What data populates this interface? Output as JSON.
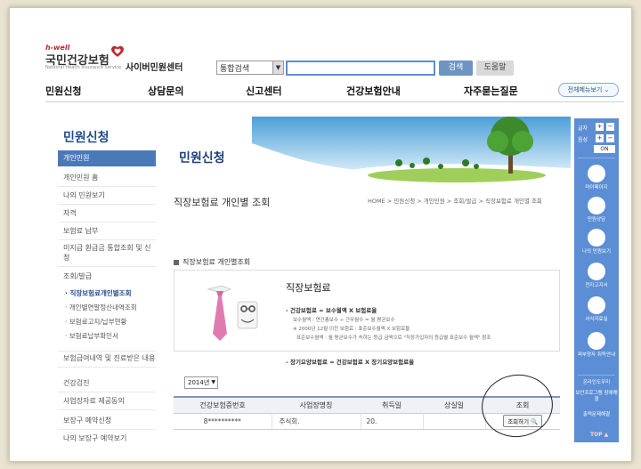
{
  "header": {
    "logo_top": "h-well",
    "logo_main": "국민건강보험",
    "logo_sub": "National Health Insurance Service",
    "center_name": "사이버민원센터",
    "search_select": "통합검색",
    "search_button": "검색",
    "help_button": "도움말",
    "all_menu": "전체메뉴보기"
  },
  "gnb": [
    "민원신청",
    "상담문의",
    "신고센터",
    "건강보험안내",
    "자주묻는질문"
  ],
  "lnb": {
    "title": "민원신청",
    "active": "개인민원",
    "items": [
      "개인민원 홈",
      "나의 민원보기",
      "자격",
      "보험료 납부",
      "미지급 환급금 통합조회 및 신청",
      "조회/발급"
    ],
    "subs": [
      "직장보험료개인별조회",
      "개인별연말정산내역조회",
      "보험료고지/납부현황",
      "보험료납부확인서"
    ],
    "items2": [
      "보험급여내역 및 진료받은 내용",
      "건강검진",
      "사업장자료 제공동의",
      "보장구 예약신청",
      "나의 보장구 예약보기"
    ]
  },
  "main": {
    "page_title": "민원신청",
    "sub_title": "직장보험료 개인별 조회",
    "breadcrumb": "HOME > 민원신청 > 개인민원 > 조회/발급 > 직장보험료 개인별 조회",
    "section_label": "직장보험료 개인별조회",
    "box_title": "직장보험료",
    "formula1": "- 건강보험료 = 보수월액 X 보험료율",
    "formula_lines": [
      "보수월액 : 연간총보수 ÷ 근무월수 = 월 평균보수",
      "※ 2000년 12월 이전 보험료 : 표준보수월액 X 보험료율",
      "표준보수월액 : 월 평균보수가 속하는 등급 금액으로 \"직장가입자의 등급별 표준보수 월액\" 참조"
    ],
    "formula2": "- 장기요양보험료 = 건강보험료 X 장기요양보험료율",
    "year": "2014년"
  },
  "table": {
    "headers": [
      "건강보험증번호",
      "사업장명칭",
      "취득일",
      "상실일",
      "조회"
    ],
    "rows": [
      {
        "card": "8**********",
        "company": "주식회.",
        "acquired": "20.",
        "lost": "",
        "action": "조회하기"
      }
    ]
  },
  "quick": {
    "font_label": "글자",
    "sound_label": "음성",
    "plus": "+",
    "minus": "−",
    "on": "ON",
    "items": [
      "마이페이지",
      "민원상담",
      "나의 민원보기",
      "전자고지서",
      "서식자료실",
      "피부양자 취득안내"
    ],
    "online_items": [
      "온라인도우미",
      "보안프로그램 장애해결",
      "출력문제해결"
    ],
    "top": "TOP ▲"
  },
  "colors": {
    "accent": "#4a79b8",
    "quick_bg": "#5b8ed4",
    "brand_red": "#c0262d"
  }
}
